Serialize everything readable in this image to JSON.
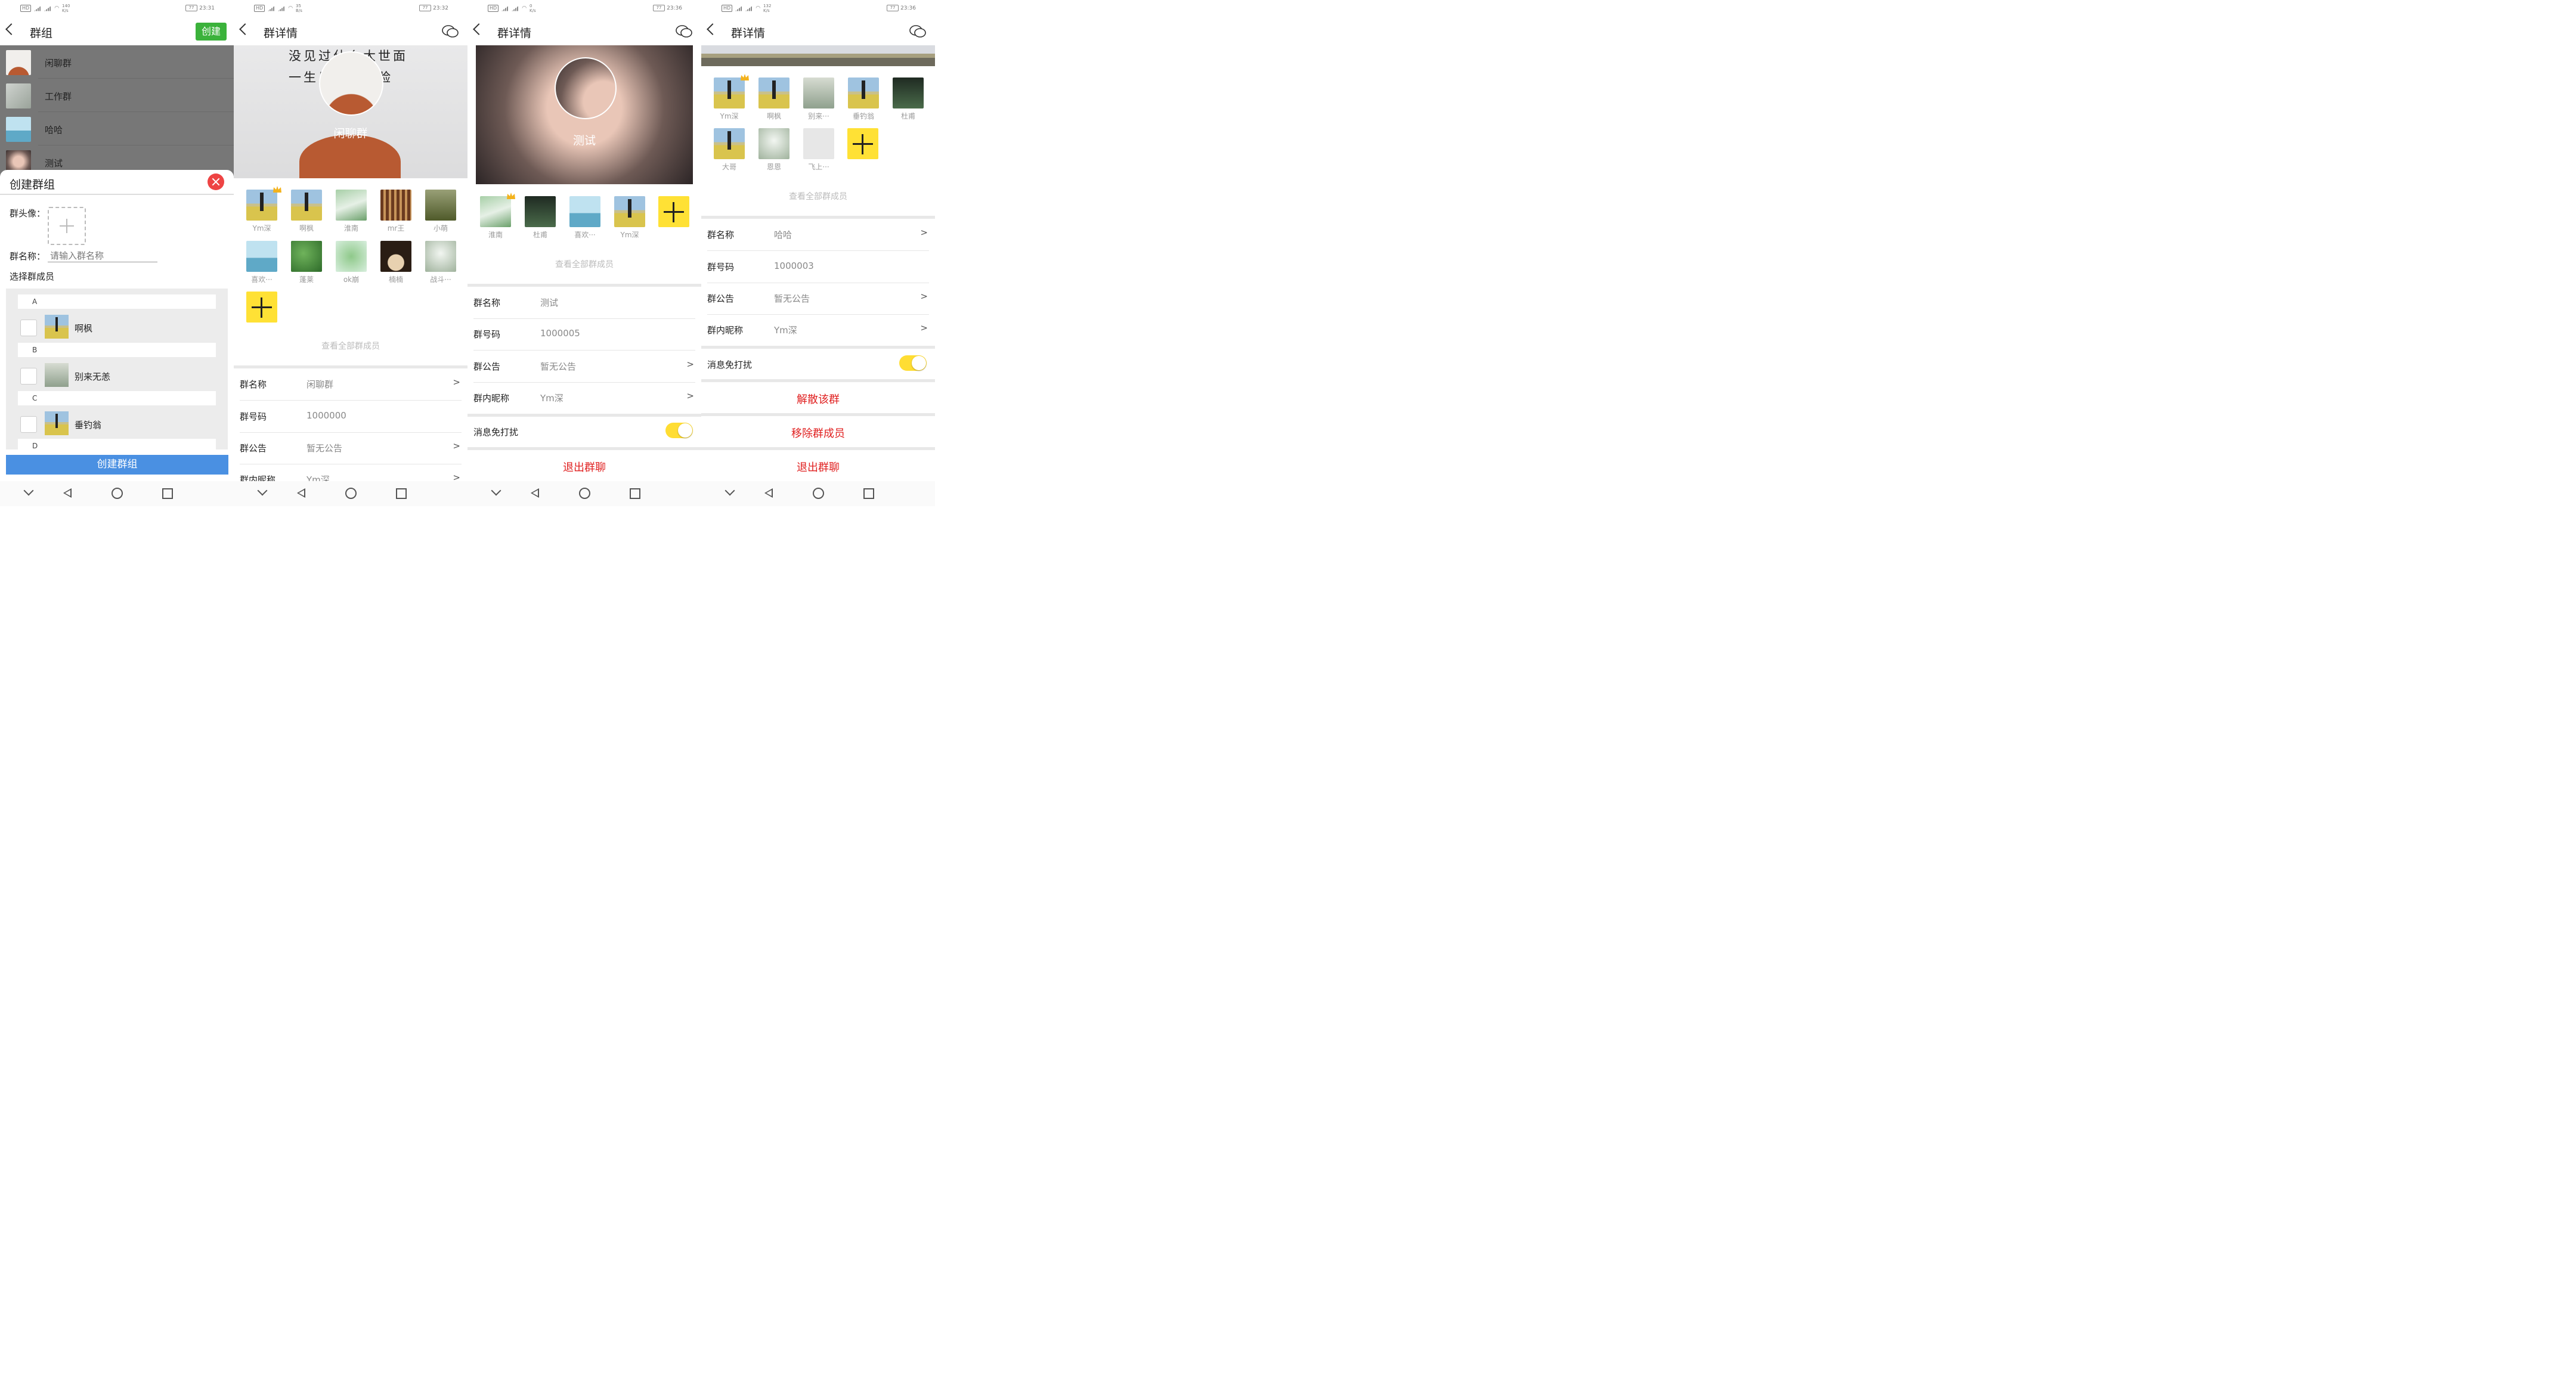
{
  "status_bars": [
    {
      "speed": "140\nK/s",
      "time": "23:31",
      "battery": "77"
    },
    {
      "speed": "35\nB/s",
      "time": "23:32",
      "battery": "77"
    },
    {
      "speed": "0\nK/s",
      "time": "23:36",
      "battery": "77"
    },
    {
      "speed": "132\nK/s",
      "time": "23:36",
      "battery": "77"
    }
  ],
  "panel1": {
    "title": "群组",
    "create_label": "创建",
    "groups": [
      "闲聊群",
      "工作群",
      "哈哈",
      "测试"
    ],
    "dialog": {
      "title": "创建群组",
      "avatar_label": "群头像：",
      "name_label": "群名称：",
      "name_placeholder": "请输入群名称",
      "select_label": "选择群成员",
      "sections": [
        {
          "letter": "A",
          "member": "啊枫"
        },
        {
          "letter": "B",
          "member": "别来无恙"
        },
        {
          "letter": "C",
          "member": "垂钓翁"
        },
        {
          "letter": "D",
          "member": ""
        }
      ],
      "submit_label": "创建群组"
    }
  },
  "panel2": {
    "title": "群详情",
    "banner_text_line1": "没见过什么大世面",
    "banner_text_line2": "一生只爱一张脸",
    "group_name": "闲聊群",
    "members": [
      "Ym深",
      "啊枫",
      "淮南",
      "mr王",
      "小萌",
      "喜欢···",
      "蓬莱",
      "ok崩",
      "楠楠",
      "战斗···"
    ],
    "view_all": "查看全部群成员",
    "rows": [
      {
        "key": "群名称",
        "value": "闲聊群",
        "arrow": ">"
      },
      {
        "key": "群号码",
        "value": "1000000",
        "arrow": ""
      },
      {
        "key": "群公告",
        "value": "暂无公告",
        "arrow": ">"
      },
      {
        "key": "群内昵称",
        "value": "Ym深",
        "arrow": ">"
      }
    ]
  },
  "panel3": {
    "title": "群详情",
    "group_name": "测试",
    "members": [
      "淮南",
      "杜甫",
      "喜欢···",
      "Ym深"
    ],
    "view_all": "查看全部群成员",
    "rows": [
      {
        "key": "群名称",
        "value": "测试",
        "arrow": ""
      },
      {
        "key": "群号码",
        "value": "1000005",
        "arrow": ""
      },
      {
        "key": "群公告",
        "value": "暂无公告",
        "arrow": ">"
      },
      {
        "key": "群内昵称",
        "value": "Ym深",
        "arrow": ">"
      }
    ],
    "mute_label": "消息免打扰",
    "mute_on": true,
    "exit_label": "退出群聊"
  },
  "panel4": {
    "title": "群详情",
    "members": [
      "Ym深",
      "啊枫",
      "别来···",
      "垂钓翁",
      "杜甫",
      "大哥",
      "恩恩",
      "飞上···"
    ],
    "view_all": "查看全部群成员",
    "rows": [
      {
        "key": "群名称",
        "value": "哈哈",
        "arrow": ">"
      },
      {
        "key": "群号码",
        "value": "1000003",
        "arrow": ""
      },
      {
        "key": "群公告",
        "value": "暂无公告",
        "arrow": ">"
      },
      {
        "key": "群内昵称",
        "value": "Ym深",
        "arrow": ">"
      }
    ],
    "mute_label": "消息免打扰",
    "mute_on": true,
    "dismiss_label": "解散该群",
    "remove_label": "移除群成员",
    "exit_label": "退出群聊"
  },
  "colors": {
    "accent_yellow": "#ffe135",
    "create_green": "#3bb23b",
    "submit_blue": "#4a90e2",
    "danger_red": "#e02020"
  }
}
